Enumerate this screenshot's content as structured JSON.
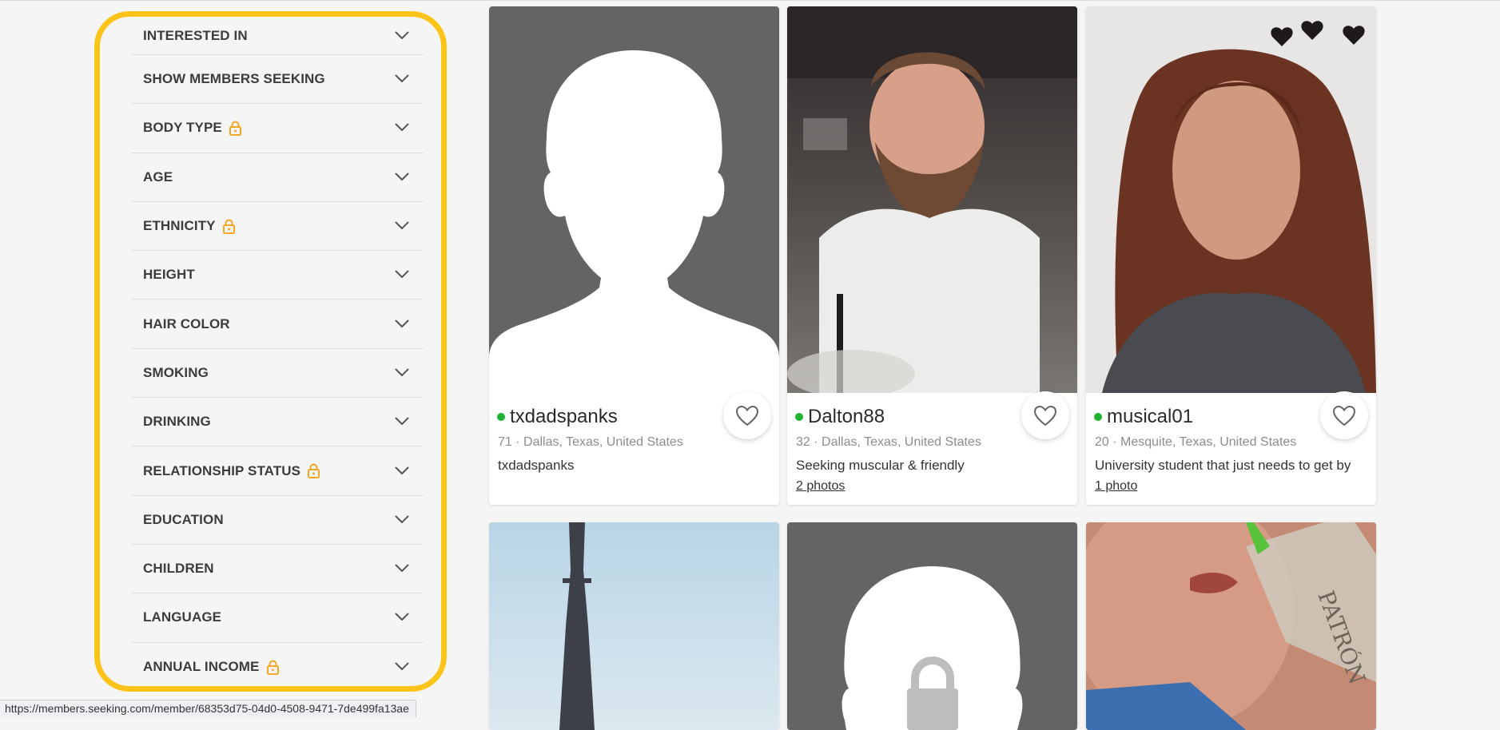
{
  "filters": [
    {
      "label": "INTERESTED IN",
      "locked": false
    },
    {
      "label": "SHOW MEMBERS SEEKING",
      "locked": false
    },
    {
      "label": "BODY TYPE",
      "locked": true
    },
    {
      "label": "AGE",
      "locked": false
    },
    {
      "label": "ETHNICITY",
      "locked": true
    },
    {
      "label": "HEIGHT",
      "locked": false
    },
    {
      "label": "HAIR COLOR",
      "locked": false
    },
    {
      "label": "SMOKING",
      "locked": false
    },
    {
      "label": "DRINKING",
      "locked": false
    },
    {
      "label": "RELATIONSHIP STATUS",
      "locked": true
    },
    {
      "label": "EDUCATION",
      "locked": false
    },
    {
      "label": "CHILDREN",
      "locked": false
    },
    {
      "label": "LANGUAGE",
      "locked": false
    },
    {
      "label": "ANNUAL INCOME",
      "locked": true
    }
  ],
  "members": [
    {
      "name": "txdadspanks",
      "meta": "71 · Dallas, Texas, United States",
      "tagline": "txdadspanks",
      "photos": "",
      "online": true
    },
    {
      "name": "Dalton88",
      "meta": "32 · Dallas, Texas, United States",
      "tagline": "Seeking muscular & friendly",
      "photos": "2 photos",
      "online": true
    },
    {
      "name": "musical01",
      "meta": "20 · Mesquite, Texas, United States",
      "tagline": "University student that just needs to get by",
      "photos": "1 photo",
      "online": true
    }
  ],
  "status_bar": {
    "url": "https://members.seeking.com/member/68353d75-04d0-4508-9471-7de499fa13ae"
  },
  "colors": {
    "highlight": "#fcc419",
    "lock": "#f5a623",
    "online": "#1fb32f",
    "placeholder_bg": "#646464"
  }
}
